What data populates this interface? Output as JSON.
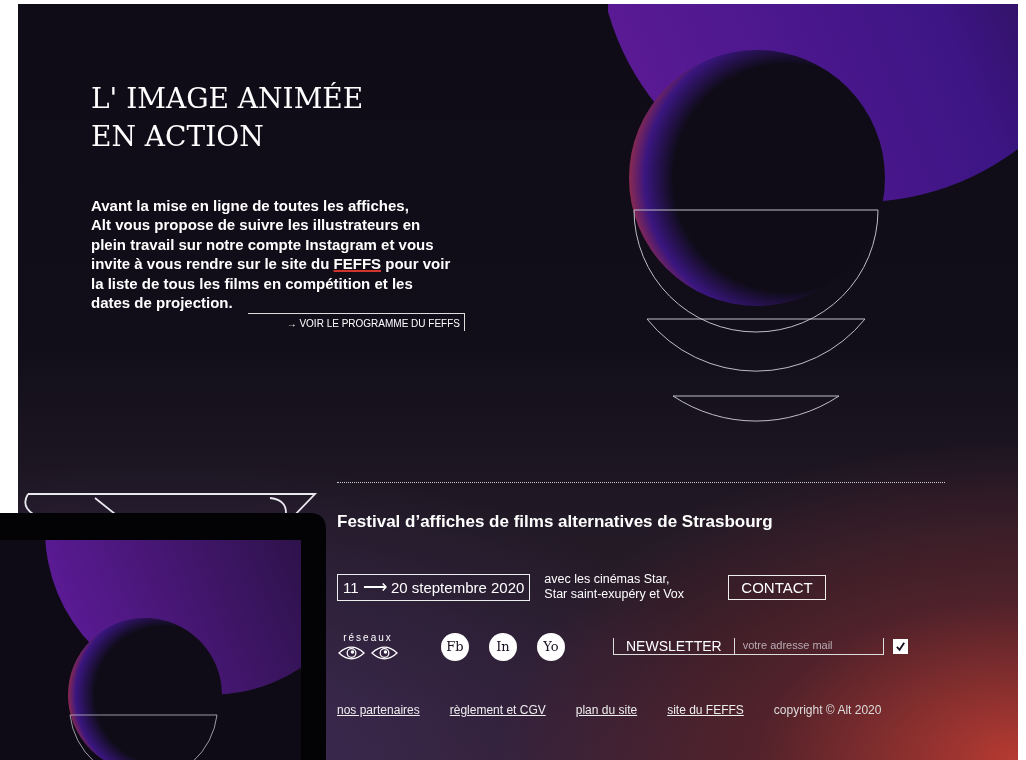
{
  "hero": {
    "title_lines": [
      "L' IMAGE ANIMÉE",
      "EN ACTION"
    ],
    "intro": {
      "before": "Avant la mise en ligne de toutes les affiches,\nAlt vous propose de suivre les illustrateurs en\nplein travail  sur notre compte Instagram et vous\ninvite à vous rendre sur le site du ",
      "link": "FEFFS",
      "after": " pour voir\nla liste de tous les films en compétition et les\ndates de projection."
    },
    "programme_link": "→ VOIR LE PROGRAMME DU FEFFS"
  },
  "footer": {
    "festival_title": "Festival d’affiches de films alternatives de Strasbourg",
    "dates": {
      "start": "11",
      "arrow": "⟶",
      "end": "20 steptembre 2020"
    },
    "venues_lines": [
      "avec les cinémas Star,",
      "Star saint-exupéry et Vox"
    ],
    "contact_button": "CONTACT",
    "networks_label": "réseaux",
    "social_buttons": [
      "Fb",
      "In",
      "Yo"
    ],
    "newsletter": {
      "label": "NEWSLETTER",
      "placeholder": "votre adresse mail",
      "checked": true
    },
    "links": [
      "nos partenaires",
      "règlement et CGV",
      "plan du site",
      "site du FEFFS"
    ],
    "copyright": "copyright © Alt 2020"
  }
}
